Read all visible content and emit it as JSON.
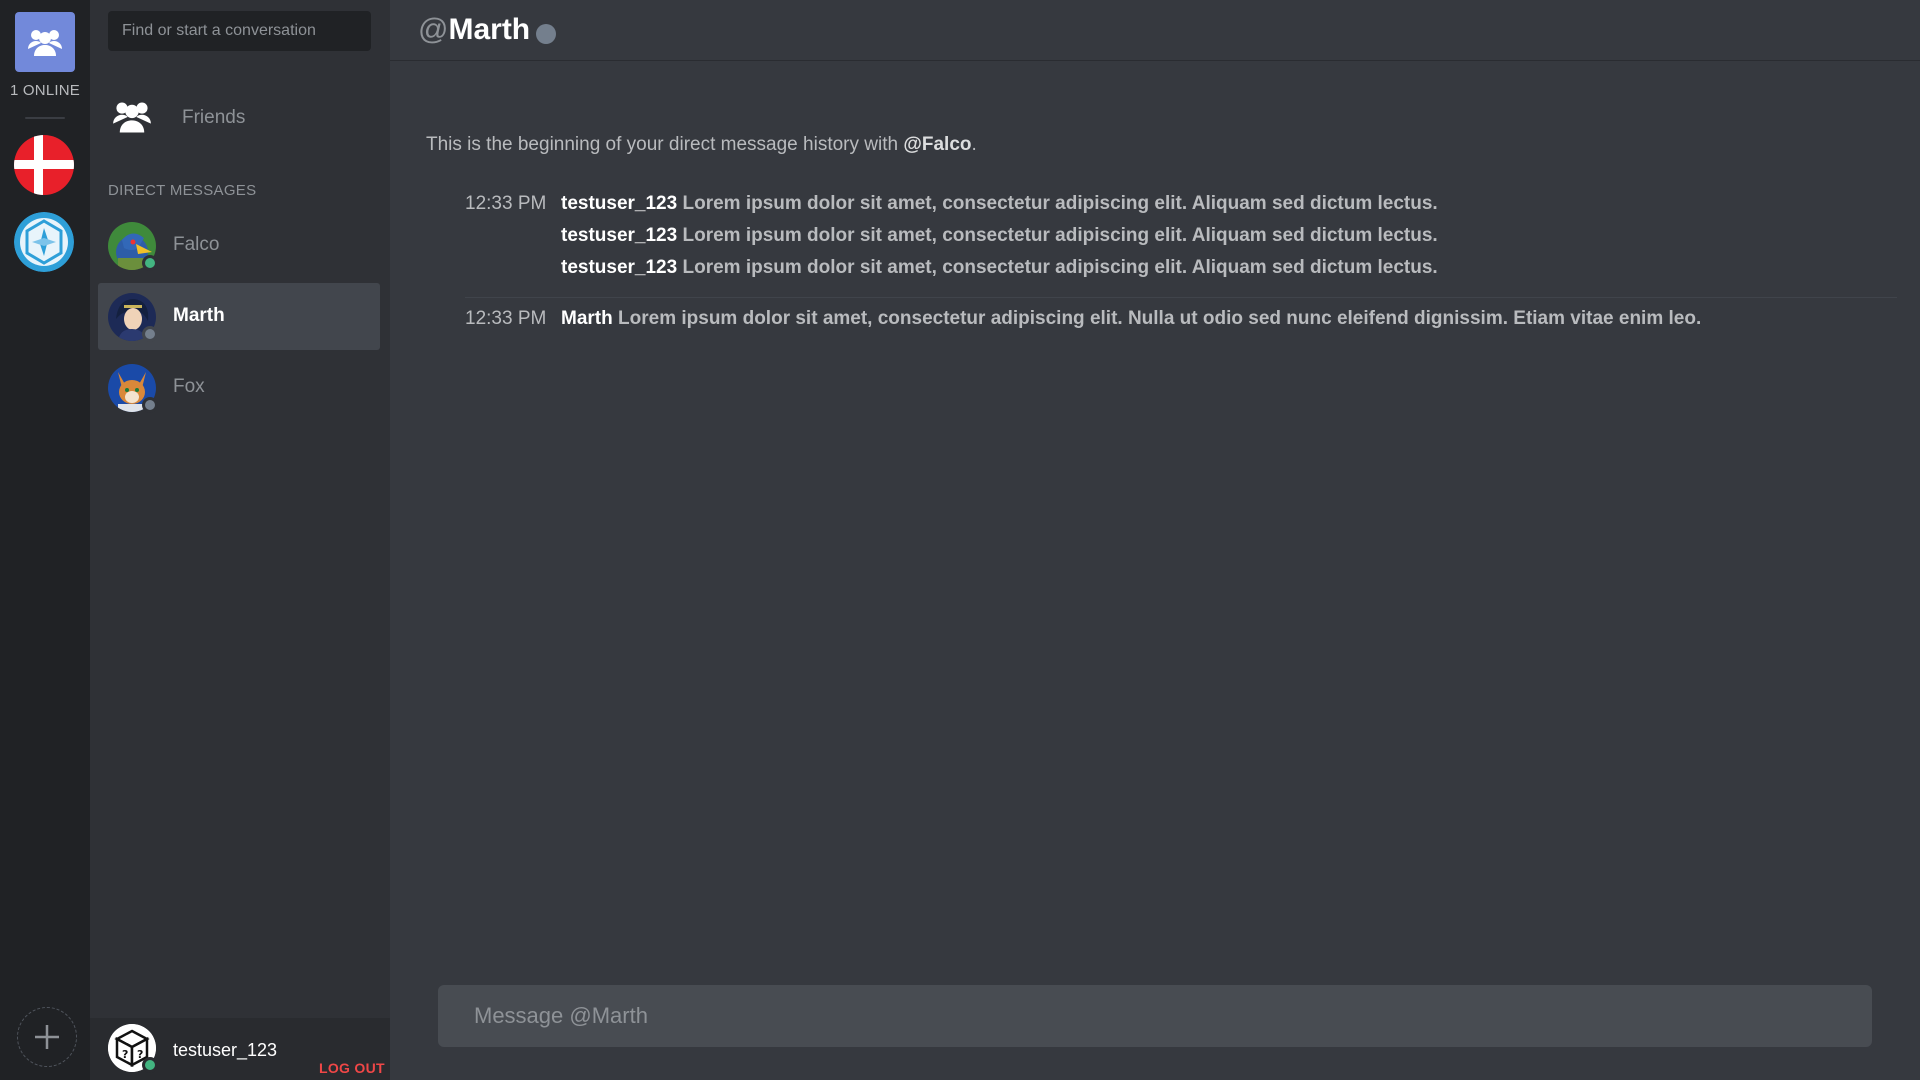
{
  "rail": {
    "online_label": "1 ONLINE",
    "servers": [
      {
        "name": "denmark-flag-icon"
      },
      {
        "name": "compass-emblem-icon"
      }
    ]
  },
  "sidebar": {
    "search_placeholder": "Find or start a conversation",
    "friends_label": "Friends",
    "dm_header": "DIRECT MESSAGES",
    "dms": [
      {
        "name": "Falco",
        "status": "online",
        "status_color": "#43b581",
        "active": false
      },
      {
        "name": "Marth",
        "status": "offline",
        "status_color": "#747f8d",
        "active": true
      },
      {
        "name": "Fox",
        "status": "offline",
        "status_color": "#747f8d",
        "active": false
      }
    ],
    "user": {
      "name": "testuser_123",
      "status_color": "#43b581",
      "logout_label": "LOG OUT"
    }
  },
  "chat": {
    "title_at": "@",
    "title_name": "Marth",
    "history_prefix": "This is the beginning of your direct message history with ",
    "history_user": "@Falco",
    "history_suffix": ".",
    "groups": [
      {
        "time": "12:33 PM",
        "messages": [
          {
            "author": "testuser_123",
            "text": "Lorem ipsum dolor sit amet, consectetur adipiscing elit. Aliquam sed dictum lectus."
          },
          {
            "author": "testuser_123",
            "text": "Lorem ipsum dolor sit amet, consectetur adipiscing elit. Aliquam sed dictum lectus."
          },
          {
            "author": "testuser_123",
            "text": "Lorem ipsum dolor sit amet, consectetur adipiscing elit. Aliquam sed dictum lectus."
          }
        ]
      },
      {
        "time": "12:33 PM",
        "messages": [
          {
            "author": "Marth",
            "text": "Lorem ipsum dolor sit amet, consectetur adipiscing elit. Nulla ut odio sed nunc eleifend dignissim. Etiam vitae enim leo."
          }
        ]
      }
    ],
    "composer_placeholder": "Message @Marth"
  },
  "colors": {
    "accent": "#7289da",
    "online": "#43b581",
    "offline": "#747f8d",
    "danger": "#f04747"
  }
}
